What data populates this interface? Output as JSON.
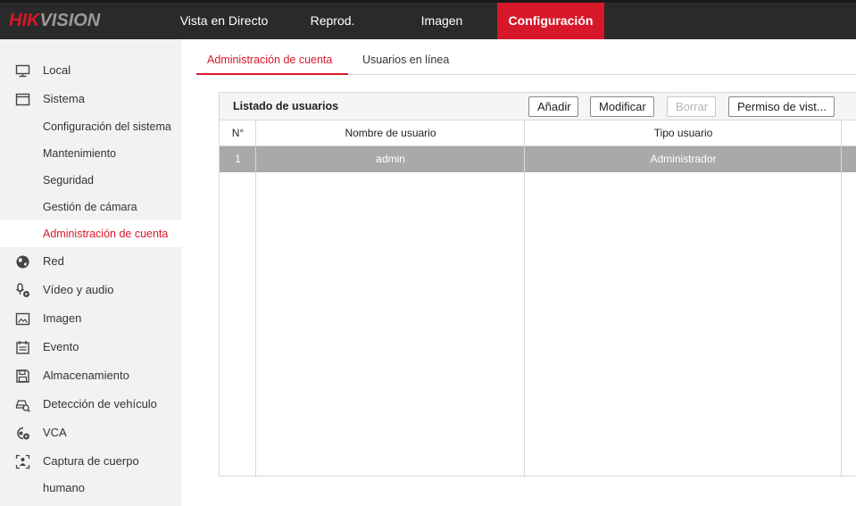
{
  "brand": {
    "part1": "HIK",
    "part2": "VISION"
  },
  "nav": [
    {
      "label": "Vista en Directo"
    },
    {
      "label": "Reprod."
    },
    {
      "label": "Imagen"
    },
    {
      "label": "Configuración"
    }
  ],
  "sidebar": {
    "local": "Local",
    "sistema": "Sistema",
    "sub": [
      "Configuración del sistema",
      "Mantenimiento",
      "Seguridad",
      "Gestión de cámara",
      "Administración de cuenta"
    ],
    "red": "Red",
    "video": "Vídeo y audio",
    "imagen": "Imagen",
    "evento": "Evento",
    "almacenamiento": "Almacenamiento",
    "deteccion": "Detección de vehículo",
    "vca": "VCA",
    "captura": "Captura de cuerpo humano"
  },
  "tabs": [
    {
      "label": "Administración de cuenta"
    },
    {
      "label": "Usuarios en línea"
    }
  ],
  "panel": {
    "title": "Listado de usuarios",
    "buttons": {
      "add": "Añadir",
      "modify": "Modificar",
      "delete": "Borrar",
      "permission": "Permiso de vist..."
    },
    "columns": {
      "num": "N°",
      "username": "Nombre de usuario",
      "type": "Tipo usuario"
    },
    "rows": [
      {
        "num": "1",
        "username": "admin",
        "type": "Administrador"
      }
    ]
  },
  "colors": {
    "accent": "#d7182a",
    "topbar": "#2a2a2a",
    "sidebar": "#f2f2f2",
    "selected_row": "#a9a9a9"
  }
}
